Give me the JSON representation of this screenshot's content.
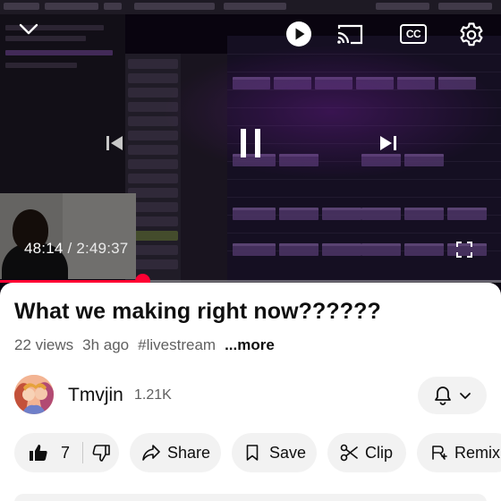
{
  "player": {
    "current_time": "48:14",
    "separator": " / ",
    "duration": "2:49:37",
    "progress": 0.284,
    "accent_color": "#ff0033",
    "icons": {
      "collapse": "chevron-down-icon",
      "autoplay": "autoplay-icon",
      "cast": "cast-icon",
      "captions": "closed-captions-icon",
      "settings": "gear-icon",
      "previous": "skip-previous-icon",
      "pause": "pause-icon",
      "next": "skip-next-icon",
      "fullscreen": "fullscreen-icon"
    },
    "captions_label": "CC"
  },
  "video": {
    "title": "What we making right now??????",
    "views": "22 views",
    "age": "3h ago",
    "hashtag": "#livestream",
    "more_label": "...more"
  },
  "channel": {
    "name": "Tmvjin",
    "subscribers": "1.21K",
    "bell_icon": "bell-icon",
    "dropdown_icon": "chevron-down-icon"
  },
  "actions": {
    "like_count": "7",
    "share_label": "Share",
    "save_label": "Save",
    "clip_label": "Clip",
    "remix_label": "Remix"
  }
}
